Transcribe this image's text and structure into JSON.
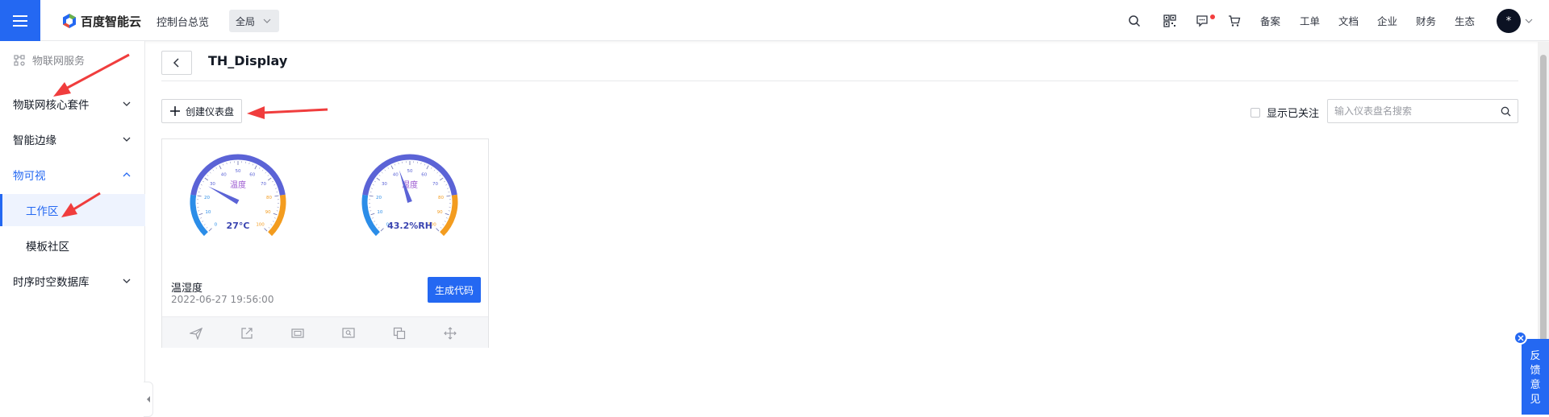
{
  "colors": {
    "brand": "#2468f2",
    "annotation_arrow": "#f03d3d",
    "gauge_blue": "#5b63d6",
    "gauge_orange": "#f39c1f"
  },
  "header": {
    "logo_text": "百度智能云",
    "console_overview": "控制台总览",
    "region": "全局",
    "icons": [
      "search-icon",
      "qrcode-icon",
      "message-icon",
      "cart-icon"
    ],
    "links": [
      "备案",
      "工单",
      "文档",
      "企业",
      "财务",
      "生态"
    ],
    "avatar_text": "*"
  },
  "sidebar": {
    "service_title": "物联网服务",
    "groups": [
      {
        "label": "物联网核心套件",
        "expanded": false
      },
      {
        "label": "智能边缘",
        "expanded": false
      },
      {
        "label": "物可视",
        "expanded": true,
        "children": [
          "工作区",
          "模板社区"
        ],
        "selected_child": "工作区"
      },
      {
        "label": "时序时空数据库",
        "expanded": false
      }
    ]
  },
  "page": {
    "title": "TH_Display",
    "create_button": "创建仪表盘",
    "follow_checkbox_label": "显示已关注",
    "search_placeholder": "输入仪表盘名搜索"
  },
  "card": {
    "name": "温湿度",
    "time": "2022-06-27 19:56:00",
    "generate_button": "生成代码",
    "gauges": [
      {
        "title": "温度",
        "value": 27,
        "display": "27°C",
        "min": 0,
        "max": 100,
        "ticks": [
          "0",
          "10",
          "20",
          "30",
          "40",
          "50",
          "60",
          "70",
          "80",
          "90",
          "100"
        ]
      },
      {
        "title": "湿度",
        "value": 43.2,
        "display": "43.2%RH",
        "min": 0,
        "max": 100,
        "ticks": [
          "0",
          "10",
          "20",
          "30",
          "40",
          "50",
          "60",
          "70",
          "80",
          "90",
          "100"
        ]
      }
    ],
    "footer_icons": [
      "send-icon",
      "external-link-icon",
      "fullscreen-icon",
      "preview-icon",
      "copy-icon",
      "move-icon"
    ]
  },
  "feedback": {
    "label": "反馈意见",
    "chars": [
      "反",
      "馈",
      "意",
      "见"
    ]
  }
}
